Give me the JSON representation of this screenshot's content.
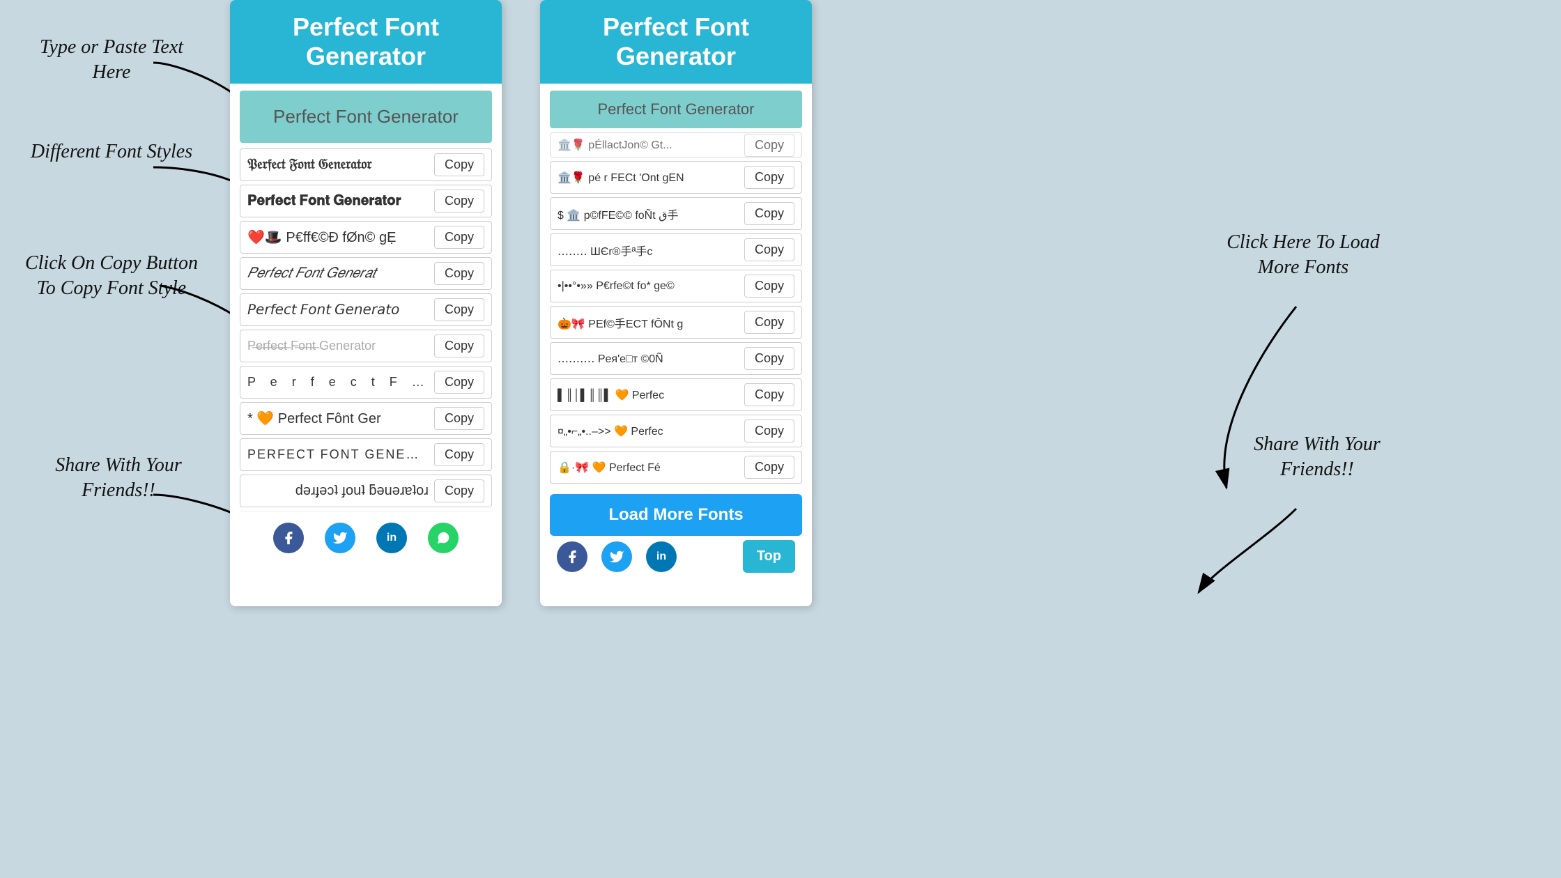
{
  "app": {
    "title": "Perfect Font Generator",
    "input_placeholder": "Perfect Font Generator"
  },
  "annotations": {
    "type_paste": "Type or Paste Text\nHere",
    "different_fonts": "Different Font\nStyles",
    "click_copy": "Click On Copy\nButton To Copy\nFont Style",
    "share_friends_left": "Share With\nYour\nFriends!!",
    "click_load": "Click Here To\nLoad More\nFonts",
    "share_friends_right": "Share With\nYour\nFriends!!"
  },
  "left_panel": {
    "header": "Perfect Font Generator",
    "input_value": "Perfect Font Generator",
    "fonts": [
      {
        "text": "𝔓𝔢𝔯𝔣𝔢𝔠𝔱 𝔉𝔬𝔫𝔱 𝔊𝔢𝔫𝔢𝔯𝔞𝔱𝔬𝔯",
        "style": "old-english",
        "copy": "Copy"
      },
      {
        "text": "𝐏𝐞𝐫𝐟𝐞𝐜𝐭 𝐅𝐨𝐧𝐭 𝐆𝐞𝐧𝐞𝐫𝐚𝐭𝐨𝐫",
        "style": "bold",
        "copy": "Copy"
      },
      {
        "text": "❤️🎩 P€ff€©Ð fØn© gẸ",
        "style": "emoji",
        "copy": "Copy"
      },
      {
        "text": "𝑃𝑒𝑟𝑓𝑒𝑐𝑡 𝐹𝑜𝑛𝑡 𝐺𝑒𝑛𝑒𝑟𝑎𝑡",
        "style": "italic",
        "copy": "Copy"
      },
      {
        "text": "𝘗𝘦𝘳𝘧𝘦𝘤𝘵 𝘍𝘰𝘯𝘵 𝘎𝘦𝘯𝘦𝘳𝘢𝘵𝘰",
        "style": "italic2",
        "copy": "Copy"
      },
      {
        "text": "P̶e̶r̶f̶e̶c̶t̶ F̶o̶n̶t̶ Generator",
        "style": "strikethrough",
        "copy": "Copy"
      },
      {
        "text": "P  e  r  f  e  c  t    F  o  n  t",
        "style": "spaced",
        "copy": "Copy"
      },
      {
        "text": "* 🧡 Perfect Fônt Ger",
        "style": "emoji2",
        "copy": "Copy"
      },
      {
        "text": "PERFECT FONT GENERATOR",
        "style": "caps",
        "copy": "Copy"
      },
      {
        "text": "ɹoʇɐɹǝuǝƃ ʇuoɟ ʇɔǝɟɹǝd",
        "style": "mirror",
        "copy": "Copy"
      }
    ],
    "social": [
      {
        "name": "facebook",
        "icon": "f",
        "color": "social-fb"
      },
      {
        "name": "twitter",
        "icon": "🐦",
        "color": "social-tw"
      },
      {
        "name": "linkedin",
        "icon": "in",
        "color": "social-li"
      },
      {
        "name": "whatsapp",
        "icon": "✓",
        "color": "social-wa"
      }
    ]
  },
  "right_panel": {
    "header": "Perfect Font Generator",
    "input_value": "Perfect Font Generator",
    "fonts": [
      {
        "text": "🏛️🌹 pé r FECt 'Ont gEN",
        "copy": "Copy"
      },
      {
        "text": "$ 🏛️ p©fFE©© foÑt ق手",
        "copy": "Copy"
      },
      {
        "text": "‥‥‥‥ Ш€r®手ª手c",
        "copy": "Copy"
      },
      {
        "text": "•|••°•»» P€rfe©t fo* ge©",
        "copy": "Copy"
      },
      {
        "text": "🎃🎀 PEf©手ECT fÔNt g",
        "copy": "Copy"
      },
      {
        "text": "‥‥‥‥‥ Pея'е□т ©0Ñ",
        "copy": "Copy"
      },
      {
        "text": "▌║│▌║║▌ 🧡 Perfec",
        "copy": "Copy"
      },
      {
        "text": "¤„•⌐„•..–>> 🧡 Perfec",
        "copy": "Copy"
      },
      {
        "text": "🔒·🎀 🧡 Perfect Fé",
        "copy": "Copy"
      }
    ],
    "load_more": "Load More Fonts",
    "top_btn": "Top",
    "social": [
      {
        "name": "facebook",
        "icon": "f",
        "color": "social-fb"
      },
      {
        "name": "twitter",
        "icon": "🐦",
        "color": "social-tw"
      },
      {
        "name": "linkedin",
        "icon": "in",
        "color": "social-li"
      }
    ]
  },
  "copy_label": "Copy"
}
